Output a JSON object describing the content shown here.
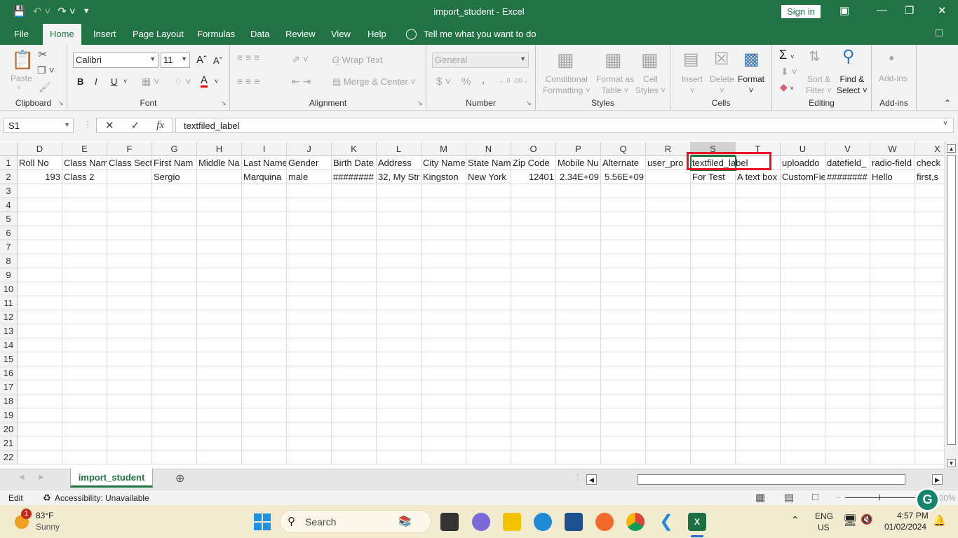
{
  "titlebar": {
    "title": "import_student  -  Excel",
    "sign_in": "Sign in",
    "qat": {
      "save": "save-icon",
      "undo": "undo-icon",
      "redo": "redo-icon",
      "customize": "customize-icon"
    }
  },
  "tabs": [
    "File",
    "Home",
    "Insert",
    "Page Layout",
    "Formulas",
    "Data",
    "Review",
    "View",
    "Help"
  ],
  "tell_me": "Tell me what you want to do",
  "ribbon": {
    "clipboard": {
      "label": "Clipboard",
      "paste": "Paste"
    },
    "font": {
      "label": "Font",
      "font_name": "Calibri",
      "font_size": "11",
      "bold": "B",
      "italic": "I",
      "underline": "U"
    },
    "alignment": {
      "label": "Alignment",
      "wrap_text": "Wrap Text",
      "merge_center": "Merge & Center"
    },
    "number": {
      "label": "Number",
      "format": "General",
      "currency": "$",
      "percent": "%",
      "comma": ","
    },
    "styles": {
      "label": "Styles",
      "conditional": "Conditional",
      "conditional2": "Formatting",
      "format_table": "Format as",
      "format_table2": "Table",
      "cell_styles": "Cell",
      "cell_styles2": "Styles"
    },
    "cells": {
      "label": "Cells",
      "insert": "Insert",
      "delete": "Delete",
      "format": "Format"
    },
    "editing": {
      "label": "Editing",
      "sort": "Sort &",
      "sort2": "Filter",
      "find": "Find &",
      "find2": "Select"
    },
    "addins": {
      "label": "Add-ins",
      "addins": "Add-ins"
    }
  },
  "formula_bar": {
    "name_box": "S1",
    "fx": "fx",
    "value": "textfiled_label"
  },
  "sheet": {
    "columns": [
      "D",
      "E",
      "F",
      "G",
      "H",
      "I",
      "J",
      "K",
      "L",
      "M",
      "N",
      "O",
      "P",
      "Q",
      "R",
      "S",
      "T",
      "U",
      "V",
      "W",
      "X"
    ],
    "selected_column": "S",
    "rows": [
      "1",
      "2",
      "3",
      "4",
      "5",
      "6",
      "7",
      "8",
      "9",
      "10",
      "11",
      "12",
      "13",
      "14",
      "15",
      "16",
      "17",
      "18",
      "19",
      "20",
      "21",
      "22"
    ],
    "row1": [
      "Roll No",
      "Class Nam",
      "Class Sect",
      "First Nam",
      "Middle Na",
      "Last Name",
      "Gender",
      "Birth Date",
      "Address",
      "City Name",
      "State Nam",
      "Zip Code",
      "Mobile Nu",
      "Alternate",
      "user_pro",
      "textfiled_label",
      "",
      "uploaddo",
      "datefield_",
      "radio-field",
      "check"
    ],
    "row2": [
      "193",
      "Class 2",
      "",
      "Sergio",
      "",
      "Marquina",
      "male",
      "########",
      "32, My Str",
      "Kingston",
      "New York",
      "12401",
      "2.34E+09",
      "5.56E+09",
      "",
      "For Test",
      "A text box",
      "CustomFie",
      "########",
      "Hello",
      "first,s"
    ]
  },
  "sheet_tabs": {
    "active": "import_student"
  },
  "status": {
    "mode": "Edit",
    "accessibility": "Accessibility: Unavailable",
    "zoom": "100%"
  },
  "taskbar": {
    "weather_temp": "83°F",
    "weather_desc": "Sunny",
    "weather_badge": "1",
    "search": "Search",
    "lang1": "ENG",
    "lang2": "US",
    "time": "4:57 PM",
    "date": "01/02/2024"
  }
}
